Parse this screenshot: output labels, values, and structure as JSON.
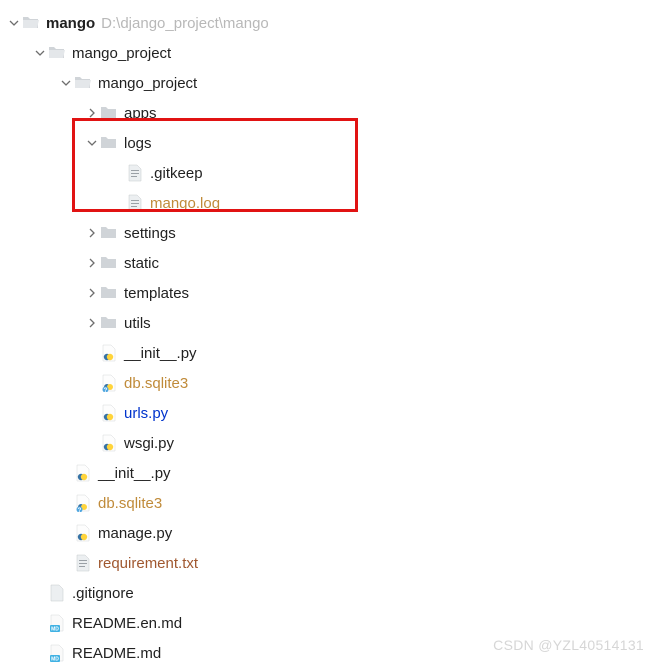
{
  "root": {
    "name": "mango",
    "path": "D:\\django_project\\mango"
  },
  "nodes": {
    "mango_project_outer": "mango_project",
    "mango_project_inner": "mango_project",
    "apps": "apps",
    "logs": "logs",
    "gitkeep": ".gitkeep",
    "mango_log": "mango.log",
    "settings": "settings",
    "static": "static",
    "templates": "templates",
    "utils": "utils",
    "init_inner": "__init__.py",
    "db_sqlite3_inner": "db.sqlite3",
    "urls": "urls.py",
    "wsgi": "wsgi.py",
    "init_outer": "__init__.py",
    "db_sqlite3_outer": "db.sqlite3",
    "manage": "manage.py",
    "requirement": "requirement.txt",
    "gitignore": ".gitignore",
    "readme_en": "README.en.md",
    "readme": "README.md"
  },
  "watermark": "CSDN @YZL40514131"
}
